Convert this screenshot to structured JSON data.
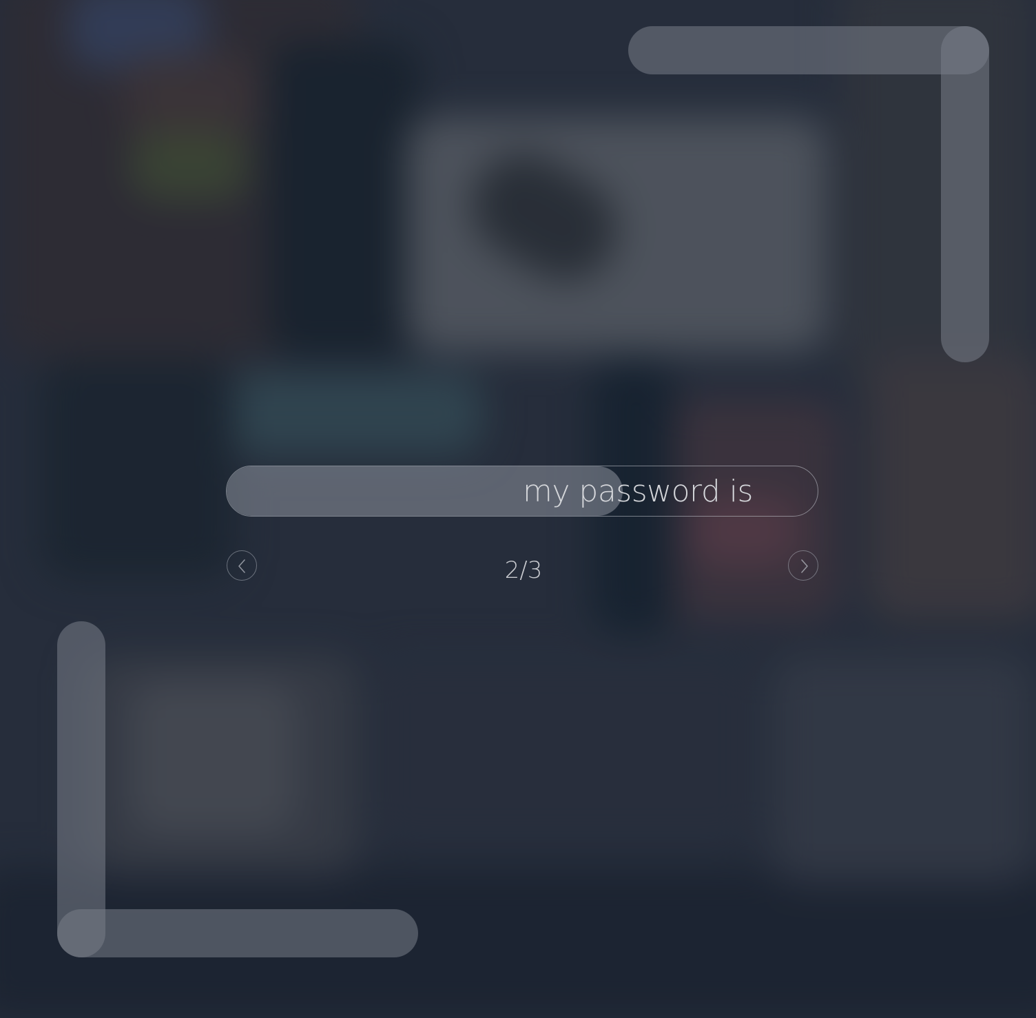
{
  "prompt_field": {
    "text": "my password is",
    "progress_fraction": 0.67
  },
  "pager": {
    "current": "2/3"
  },
  "icons": {
    "prev": "chevron-left-icon",
    "next": "chevron-right-icon"
  },
  "colors": {
    "bracket": "#787e88",
    "text": "#d4d6da"
  }
}
